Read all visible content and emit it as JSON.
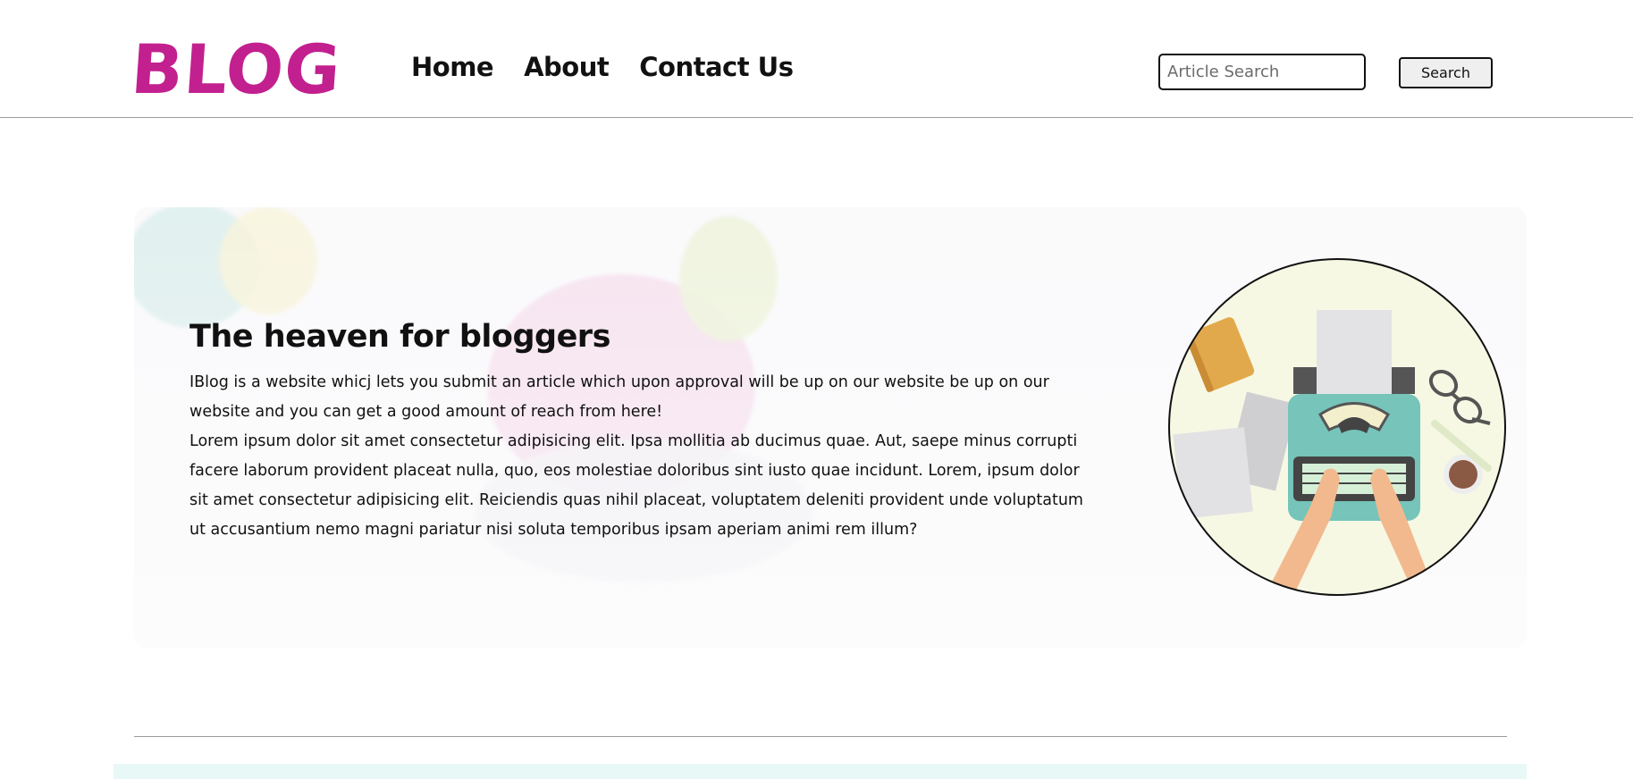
{
  "header": {
    "logo": "BLOG",
    "nav": [
      "Home",
      "About",
      "Contact Us"
    ],
    "search": {
      "placeholder": "Article Search",
      "button_label": "Search"
    }
  },
  "hero": {
    "title": "The heaven for bloggers",
    "paragraph_1": "IBlog is a website whicj lets you submit an article which upon approval will be up on our website be up on our website and you can get a good amount of reach from here!",
    "paragraph_2": "Lorem ipsum dolor sit amet consectetur adipisicing elit. Ipsa mollitia ab ducimus quae. Aut, saepe minus corrupti facere laborum provident placeat nulla, quo, eos molestiae doloribus sint iusto quae incidunt. Lorem, ipsum dolor sit amet consectetur adipisicing elit. Reiciendis quas nihil placeat, voluptatem deleniti provident unde voluptatum ut accusantium nemo magni pariatur nisi soluta temporibus ipsam aperiam animi rem illum?",
    "illustration_icon": "typewriter-illustration"
  },
  "colors": {
    "brand": "#c2208f",
    "text": "#111111",
    "divider": "#9a9a9a",
    "footer_strip": "#e8f8f6"
  }
}
